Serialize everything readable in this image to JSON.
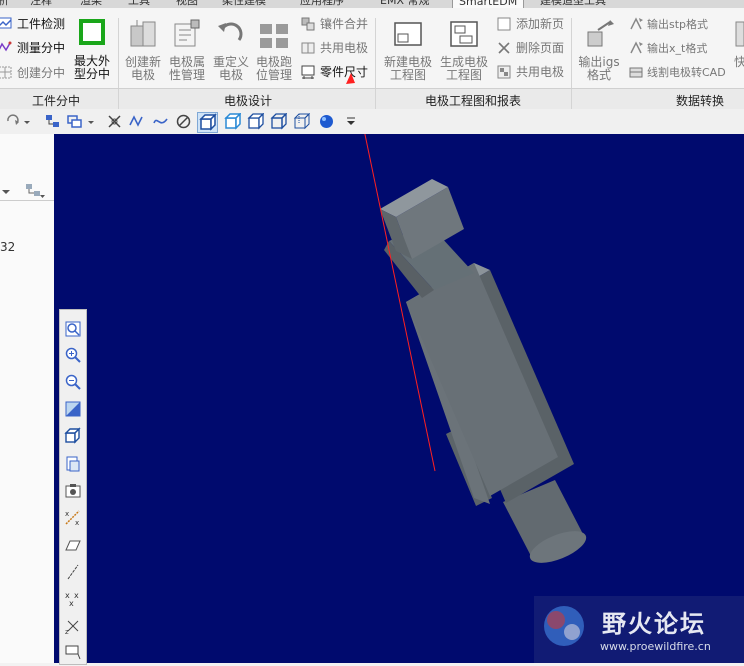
{
  "tabs": [
    "析",
    "注释",
    "渲染",
    "工具",
    "视图",
    "柔性建模",
    "应用程序",
    "EMX 常规",
    "SmartEDM",
    "建模造型工具"
  ],
  "ribbon": {
    "workpiece_group": {
      "label": "工件分中",
      "items": [
        "工件检测",
        "测量分中",
        "创建分中"
      ],
      "max_center_label_line1": "最大外",
      "max_center_label_line2": "型分中"
    },
    "electrode_group": {
      "label": "电极设计",
      "create_line1": "创建新",
      "create_line2": "电极",
      "attr_line1": "电极属",
      "attr_line2": "性管理",
      "redefine_line1": "重定义",
      "redefine_line2": "电极",
      "track_line1": "电极跑",
      "track_line2": "位管理",
      "small_items": [
        "镶件合并",
        "共用电极",
        "零件尺寸"
      ]
    },
    "drawing_group": {
      "label": "电极工程图和报表",
      "new_drawing_line1": "新建电极",
      "new_drawing_line2": "工程图",
      "gen_drawing_line1": "生成电极",
      "gen_drawing_line2": "工程图",
      "small_items": [
        "添加新页",
        "删除页面",
        "共用电极"
      ]
    },
    "convert_group": {
      "label": "数据转换",
      "igs_line1": "输出igs",
      "igs_line2": "格式",
      "small_items": [
        "输出stp格式",
        "输出x_t格式",
        "线割电极转CAD"
      ],
      "fast_label": "快"
    }
  },
  "left_panel": {
    "fragment": "32"
  },
  "watermark": {
    "title": "野火论坛",
    "url": "www.proewildfire.cn"
  },
  "colors": {
    "viewport_bg": "#000a6e",
    "model_grey": "#6b7379",
    "annotation_red": "#ff2020",
    "max_center_green": "#1aa61a"
  }
}
